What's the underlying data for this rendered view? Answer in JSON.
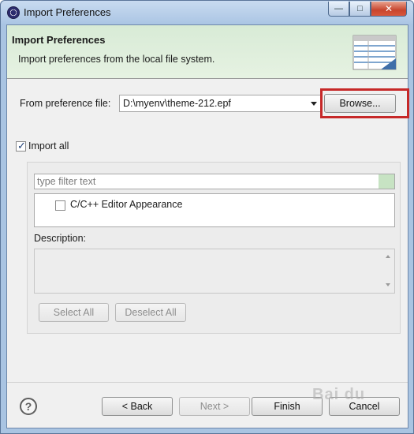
{
  "window": {
    "title": "Import Preferences",
    "controls": {
      "minimize": "—",
      "maximize": "□",
      "close": "✕"
    }
  },
  "banner": {
    "title": "Import Preferences",
    "description": "Import preferences from the local file system."
  },
  "source": {
    "label": "From preference file:",
    "value": "D:\\myenv\\theme-212.epf",
    "browse_label": "Browse..."
  },
  "import_all": {
    "label": "Import all",
    "checked": true
  },
  "filter": {
    "placeholder": "type filter text"
  },
  "tree": {
    "items": [
      {
        "label": "C/C++ Editor Appearance",
        "checked": false
      }
    ]
  },
  "description": {
    "label": "Description:"
  },
  "selection_buttons": {
    "select_all": "Select All",
    "deselect_all": "Deselect All"
  },
  "footer": {
    "back": "< Back",
    "next": "Next >",
    "finish": "Finish",
    "cancel": "Cancel"
  },
  "watermark": {
    "text": "Bai du"
  },
  "colors": {
    "banner_bg": "#dcedd9",
    "highlight_border": "#c62828",
    "titlebar": "#aac5e4"
  }
}
